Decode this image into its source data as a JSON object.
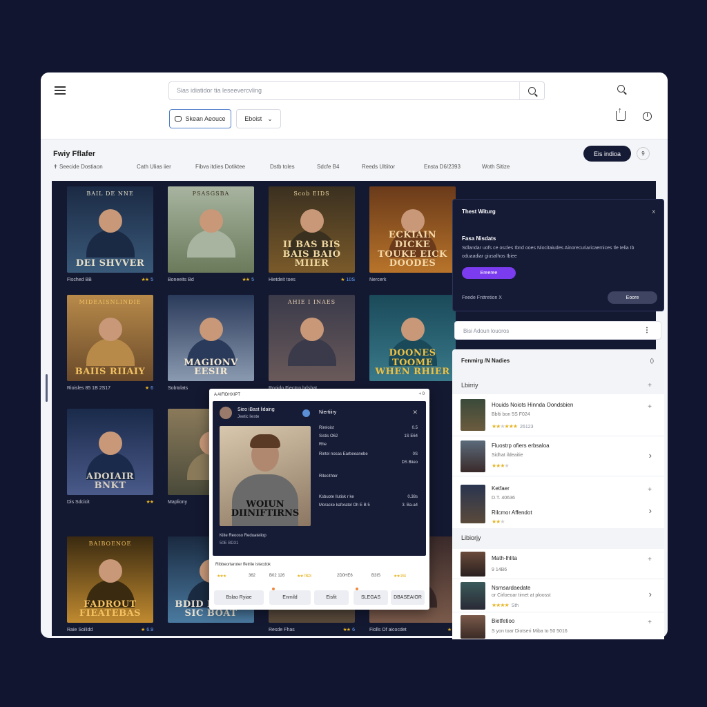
{
  "topbar": {
    "search_placeholder": "Sias idiatidor tia leseevercvling",
    "account_button": "Skean Aeouce",
    "dropdown_value": "Eboist"
  },
  "header": {
    "title": "Fwiy Fflafer",
    "filters": [
      "Seecide  Dostiaon",
      "Cath Ulias iier",
      "Fibva itdies Dotiktee",
      "Dstb toles",
      "Sdcfe B4",
      "Reeds Ultiitor",
      "Ensta D6/2393",
      "Woth Sitize"
    ],
    "action_button": "Eis indioa",
    "action_circle": "9"
  },
  "posters": [
    {
      "top": "BAIL DE NNE",
      "title": "DEI SHVVER",
      "label": "Fisched BB",
      "stars": "★★",
      "num": "5"
    },
    {
      "top": "PSASGSBA",
      "title": "",
      "label": "Boneeits Bd",
      "stars": "★★",
      "num": "5"
    },
    {
      "top": "Scob  EIDS",
      "title": "II BAS BIS\nBAIS BAIO MIIER",
      "label": "Hietdeit toes",
      "stars": "★",
      "num": "10S"
    },
    {
      "top": "",
      "title": "ECKIAIN DICKE\nTOUKE EICK DOODES",
      "label": "Nercerk",
      "stars": "",
      "num": ""
    },
    {
      "top": "MIDEAISNLINDIE",
      "title": "BAIIS RIIAIY",
      "label": "Rioisles  85 1B 2S17",
      "stars": "★",
      "num": "6"
    },
    {
      "top": "",
      "title": "MAGIONV EESIR",
      "label": "Sobtolats",
      "stars": "",
      "num": ""
    },
    {
      "top": "AHIE I INAES",
      "title": "",
      "label": "Rooido Fiecton  hdsbat",
      "stars": "",
      "num": ""
    },
    {
      "top": "",
      "title": "DOONES TOOME\nWHEN RHIER",
      "label": "",
      "stars": "",
      "num": ""
    },
    {
      "top": "",
      "title": "ADOIAIR BNKT",
      "label": "Dis Sdcicit",
      "stars": "★★",
      "num": ""
    },
    {
      "top": "",
      "title": "",
      "label": "Mapliony",
      "stars": "",
      "num": ""
    },
    {
      "top": "BAIBOENOE",
      "title": "FADROUT\nFIEATEBAS",
      "label": "Raie Soilidd",
      "stars": "★",
      "num": "6.9"
    },
    {
      "top": "",
      "title": "BDID D BOAI SIC BOAT",
      "label": "",
      "stars": "",
      "num": ""
    },
    {
      "top": "",
      "title": "",
      "label": "Resde Fhas",
      "stars": "★★",
      "num": "6"
    },
    {
      "top": "",
      "title": "",
      "label": "Fiolls Of aicocdet",
      "stars": "★",
      "num": "6"
    }
  ],
  "modal": {
    "title": "Thest Witurg",
    "close": "x",
    "subtitle": "Fasa Nisdats",
    "body": "Sdlandar uofs ce oscles Ibnd ooes Niocitaiudes Ainorecuriaricaemices tle Ielia Ib oduaadiar giusalhos Ibiee",
    "button": "Ereeree",
    "footer_text": "Feede Fnttretion X",
    "footer_button": "Eoore"
  },
  "side_search": {
    "placeholder": "Bisi Adoun louoros"
  },
  "side_panel": {
    "header": "Fenmirg /N Nadies",
    "header_right": "()",
    "section1": "Lbirriy",
    "section2": "Libiorjy",
    "items": [
      {
        "title": "Houids Noiots Hinnda Oondsbien",
        "sub": "Bblti bon  5S F024",
        "stars": "★★",
        "num": "26123"
      },
      {
        "title": "Fluostrp ofiers erbsaloa",
        "sub": "Sidhat ildeaitie",
        "stars": "★★★",
        "num": ""
      },
      {
        "title": "Ketfaer",
        "sub": "D.T. 40636",
        "title2": "Rilcmor Affendot",
        "stars": "★★",
        "num": ""
      },
      {
        "title": "Math-lhlita",
        "sub": "9   14B6",
        "stars": "",
        "num": ""
      },
      {
        "title": "Nsmsardaedate",
        "sub": "or Cirloeoar timet at ploosst",
        "stars": "★★★★",
        "num": "Sth"
      },
      {
        "title": "Bietfetioo",
        "sub": "S yon  toar Diotseri Miba to 50 5016",
        "stars": "",
        "num": ""
      }
    ]
  },
  "detail": {
    "topbar_left": "A  AIFIDHXIPT",
    "topbar_right": "+ 0",
    "name": "Sieo iBast lidaing",
    "name_sub": "Jeetic lieste",
    "right_title": "Niertiiiry",
    "poster_title": "WOIUN\nDIINIFTIRNS",
    "info": [
      {
        "l": "Rireloist",
        "r": "0.5"
      },
      {
        "l": "Sistis  O62",
        "r": "1S  E64"
      },
      {
        "l": "Rhe",
        "r": ""
      },
      {
        "l": "Rintel nosas Earbeeanebe",
        "r": "0S"
      },
      {
        "l": "",
        "r": "DS Biieo"
      },
      {
        "l": "Ritecithter",
        "r": ""
      },
      {
        "l": "Ksbuote  Ilutisk  r ke",
        "r": "0.38s"
      },
      {
        "l": "Moracke kaforatel  Oh E  B 5",
        "r": "3. Ba-a4"
      }
    ],
    "bottom_a": "Kiite Reooso  Reduateiiop",
    "bottom_b": "50E BD31",
    "section": "Ribbeortaroter ffetriie istecdok",
    "ratings": [
      "★★★",
      "362",
      "B02 126",
      "★★ 7 B23",
      "2D0HE6",
      "B3IS",
      "★★ 1S4"
    ],
    "tabs": [
      "Bslao Ryiae",
      "Enmild",
      "Eisfit",
      "SLEGAS",
      "DBASEAIOR"
    ]
  }
}
